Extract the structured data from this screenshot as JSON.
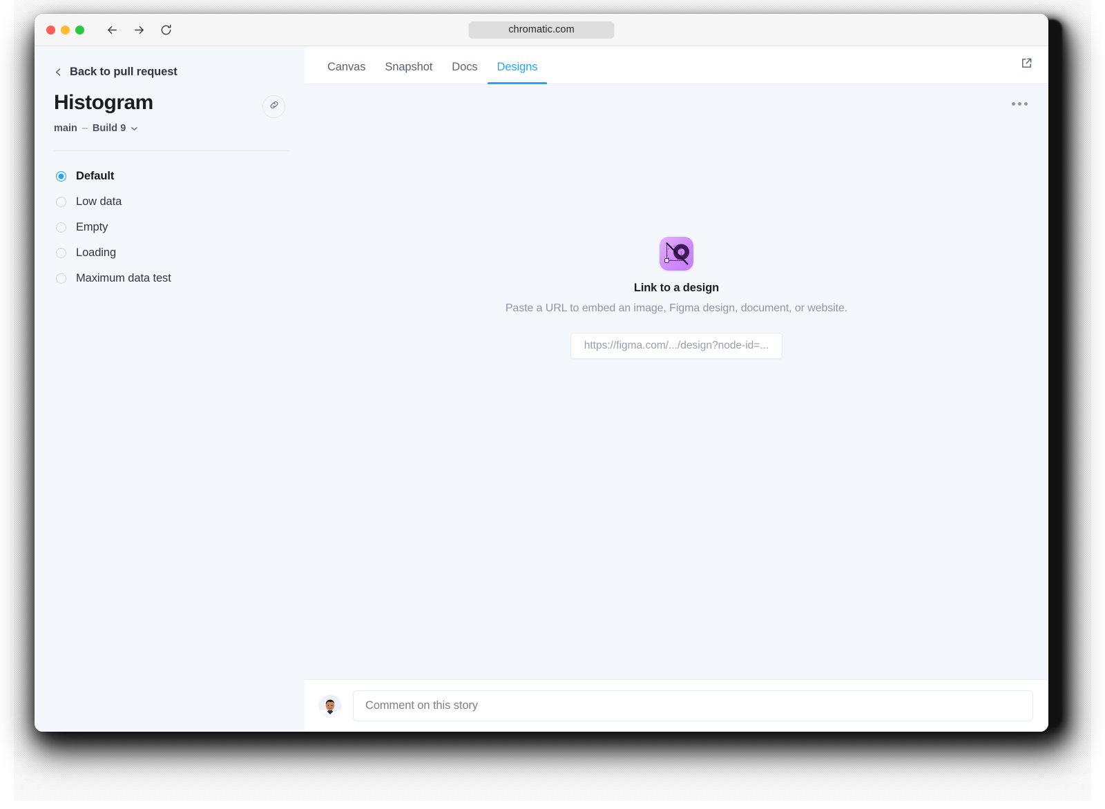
{
  "browser": {
    "url": "chromatic.com",
    "back_icon": "arrow-left-icon",
    "forward_icon": "arrow-right-icon",
    "reload_icon": "reload-icon",
    "traffic_lights": [
      "close",
      "minimize",
      "zoom"
    ]
  },
  "sidebar": {
    "back_label": "Back to pull request",
    "title": "Histogram",
    "branch": "main",
    "separator": "–",
    "build": "Build 9",
    "link_icon": "link-icon",
    "caret_icon": "chevron-down-icon",
    "stories": [
      {
        "label": "Default",
        "selected": true
      },
      {
        "label": "Low data",
        "selected": false
      },
      {
        "label": "Empty",
        "selected": false
      },
      {
        "label": "Loading",
        "selected": false
      },
      {
        "label": "Maximum data test",
        "selected": false
      }
    ]
  },
  "main": {
    "tabs": [
      {
        "label": "Canvas",
        "active": false
      },
      {
        "label": "Snapshot",
        "active": false
      },
      {
        "label": "Docs",
        "active": false
      },
      {
        "label": "Designs",
        "active": true
      }
    ],
    "external_link_icon": "external-link-icon",
    "kebab_icon": "more-horizontal-icon",
    "empty_state": {
      "icon": "design-link-icon",
      "title": "Link to a design",
      "subtitle": "Paste a URL to embed an image, Figma design, document, or website.",
      "input_placeholder": "https://figma.com/.../design?node-id=..."
    }
  },
  "comment": {
    "avatar": "user-avatar",
    "placeholder": "Comment on this story"
  },
  "colors": {
    "accent": "#1ea7fd",
    "canvas_bg": "#f4f7fc",
    "panel_bg": "#ffffff",
    "text_primary": "#1a1c22",
    "text_muted": "#8f97a4",
    "icon_purple": "#c77dfb"
  }
}
